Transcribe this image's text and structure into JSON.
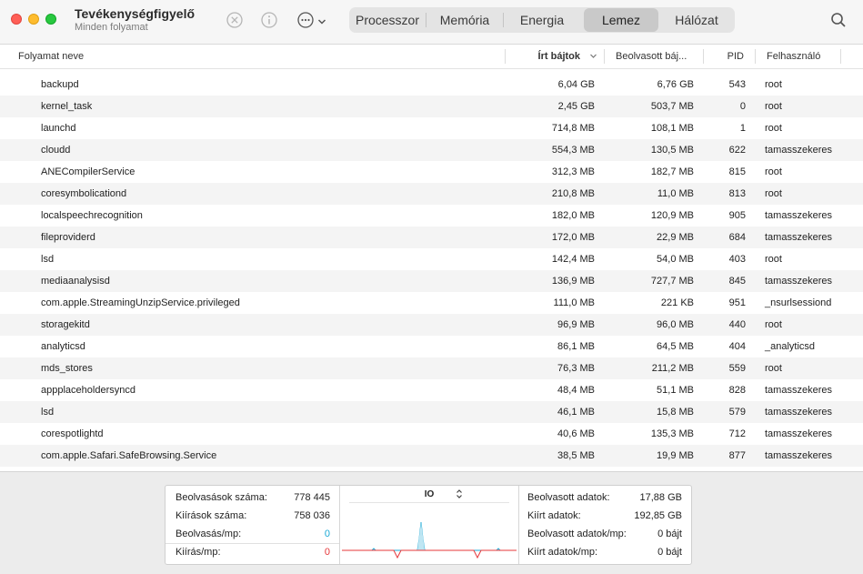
{
  "app": {
    "title": "Tevékenységfigyelő",
    "subtitle": "Minden folyamat"
  },
  "toolbar": {
    "icons": [
      "stop-icon",
      "info-icon",
      "more-icon",
      "chevron-down-icon",
      "search-icon"
    ],
    "tabs": [
      {
        "label": "Processzor",
        "active": false
      },
      {
        "label": "Memória",
        "active": false
      },
      {
        "label": "Energia",
        "active": false
      },
      {
        "label": "Lemez",
        "active": true
      },
      {
        "label": "Hálózat",
        "active": false
      }
    ]
  },
  "table": {
    "headers": {
      "name": "Folyamat neve",
      "bytes_written": "Írt bájtok",
      "bytes_read": "Beolvasott báj...",
      "pid": "PID",
      "user": "Felhasználó"
    },
    "rows": [
      {
        "name": "backupd",
        "written": "6,04 GB",
        "read": "6,76 GB",
        "pid": "543",
        "user": "root"
      },
      {
        "name": "kernel_task",
        "written": "2,45 GB",
        "read": "503,7 MB",
        "pid": "0",
        "user": "root"
      },
      {
        "name": "launchd",
        "written": "714,8 MB",
        "read": "108,1 MB",
        "pid": "1",
        "user": "root"
      },
      {
        "name": "cloudd",
        "written": "554,3 MB",
        "read": "130,5 MB",
        "pid": "622",
        "user": "tamasszekeres"
      },
      {
        "name": "ANECompilerService",
        "written": "312,3 MB",
        "read": "182,7 MB",
        "pid": "815",
        "user": "root"
      },
      {
        "name": "coresymbolicationd",
        "written": "210,8 MB",
        "read": "11,0 MB",
        "pid": "813",
        "user": "root"
      },
      {
        "name": "localspeechrecognition",
        "written": "182,0 MB",
        "read": "120,9 MB",
        "pid": "905",
        "user": "tamasszekeres"
      },
      {
        "name": "fileproviderd",
        "written": "172,0 MB",
        "read": "22,9 MB",
        "pid": "684",
        "user": "tamasszekeres"
      },
      {
        "name": "lsd",
        "written": "142,4 MB",
        "read": "54,0 MB",
        "pid": "403",
        "user": "root"
      },
      {
        "name": "mediaanalysisd",
        "written": "136,9 MB",
        "read": "727,7 MB",
        "pid": "845",
        "user": "tamasszekeres"
      },
      {
        "name": "com.apple.StreamingUnzipService.privileged",
        "written": "111,0 MB",
        "read": "221 KB",
        "pid": "951",
        "user": "_nsurlsessiond"
      },
      {
        "name": "storagekitd",
        "written": "96,9 MB",
        "read": "96,0 MB",
        "pid": "440",
        "user": "root"
      },
      {
        "name": "analyticsd",
        "written": "86,1 MB",
        "read": "64,5 MB",
        "pid": "404",
        "user": "_analyticsd"
      },
      {
        "name": "mds_stores",
        "written": "76,3 MB",
        "read": "211,2 MB",
        "pid": "559",
        "user": "root"
      },
      {
        "name": "appplaceholdersyncd",
        "written": "48,4 MB",
        "read": "51,1 MB",
        "pid": "828",
        "user": "tamasszekeres"
      },
      {
        "name": "lsd",
        "written": "46,1 MB",
        "read": "15,8 MB",
        "pid": "579",
        "user": "tamasszekeres"
      },
      {
        "name": "corespotlightd",
        "written": "40,6 MB",
        "read": "135,3 MB",
        "pid": "712",
        "user": "tamasszekeres"
      },
      {
        "name": "com.apple.Safari.SafeBrowsing.Service",
        "written": "38,5 MB",
        "read": "19,9 MB",
        "pid": "877",
        "user": "tamasszekeres"
      }
    ]
  },
  "stats": {
    "left": [
      {
        "label": "Beolvasások száma:",
        "value": "778 445"
      },
      {
        "label": "Kiírások száma:",
        "value": "758 036"
      },
      {
        "label": "Beolvasás/mp:",
        "value": "0"
      },
      {
        "label": "Kiírás/mp:",
        "value": "0"
      }
    ],
    "graph_title": "IO",
    "right": [
      {
        "label": "Beolvasott adatok:",
        "value": "17,88 GB"
      },
      {
        "label": "Kiírt adatok:",
        "value": "192,85 GB"
      },
      {
        "label": "Beolvasott adatok/mp:",
        "value": "0 bájt"
      },
      {
        "label": "Kiírt adatok/mp:",
        "value": "0 bájt"
      }
    ],
    "colors": {
      "read": "#1aa9d6",
      "write": "#e5373a"
    }
  }
}
